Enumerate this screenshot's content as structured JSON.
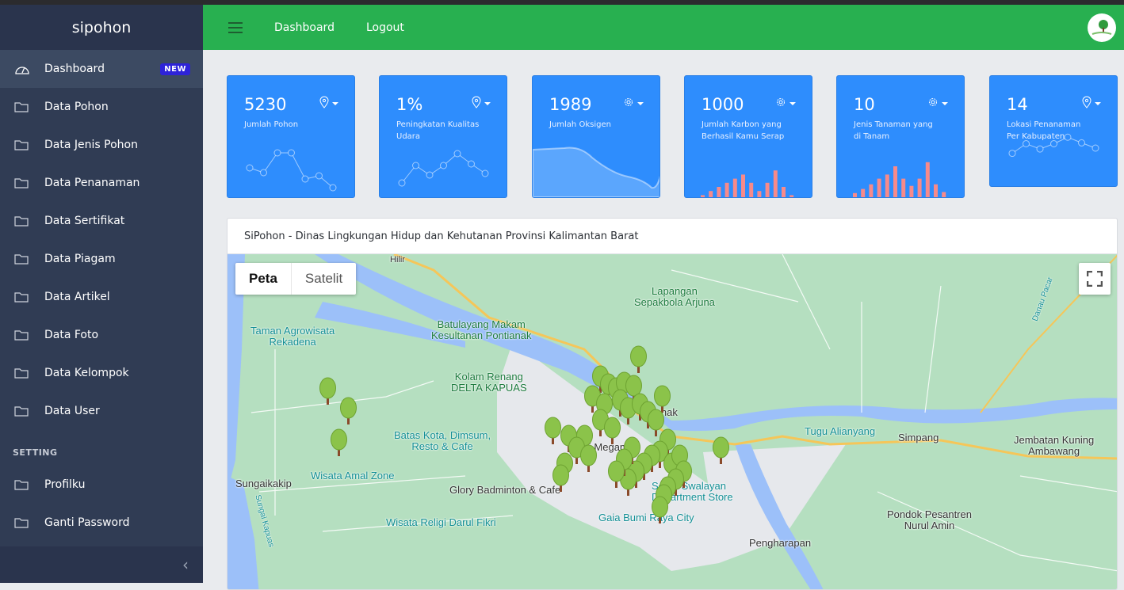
{
  "app": {
    "brand": "sipohon"
  },
  "header": {
    "links": [
      "Dashboard",
      "Logout"
    ]
  },
  "sidebar": {
    "items": [
      {
        "label": "Dashboard",
        "icon": "gauge-icon",
        "badge": "NEW",
        "active": true
      },
      {
        "label": "Data Pohon",
        "icon": "folder-icon"
      },
      {
        "label": "Data Jenis Pohon",
        "icon": "folder-icon"
      },
      {
        "label": "Data Penanaman",
        "icon": "folder-icon"
      },
      {
        "label": "Data Sertifikat",
        "icon": "folder-icon"
      },
      {
        "label": "Data Piagam",
        "icon": "folder-icon"
      },
      {
        "label": "Data Artikel",
        "icon": "folder-icon"
      },
      {
        "label": "Data Foto",
        "icon": "folder-icon"
      },
      {
        "label": "Data Kelompok",
        "icon": "folder-icon"
      },
      {
        "label": "Data User",
        "icon": "folder-icon"
      }
    ],
    "section": "SETTING",
    "settings": [
      {
        "label": "Profilku",
        "icon": "folder-icon"
      },
      {
        "label": "Ganti Password",
        "icon": "folder-icon"
      }
    ]
  },
  "cards": [
    {
      "value": "5230",
      "label": "Jumlah Pohon",
      "icon": "map-pin-icon",
      "chart": "line",
      "spark": [
        65,
        59,
        84,
        84,
        51,
        55,
        40
      ]
    },
    {
      "value": "1%",
      "label": "Peningkatan Kualitas Udara",
      "icon": "map-pin-icon",
      "chart": "line",
      "spark": [
        1,
        18,
        9,
        17,
        3,
        5,
        40
      ]
    },
    {
      "value": "1989",
      "label": "Jumlah Oksigen",
      "icon": "gear-icon",
      "chart": "area",
      "spark": [
        78,
        81,
        80,
        45,
        55,
        34,
        40
      ]
    },
    {
      "value": "1000",
      "label": "Jumlah Karbon yang Berhasil Kamu Serap",
      "icon": "gear-icon",
      "chart": "bar",
      "spark": [
        4,
        12,
        20,
        28,
        36,
        44,
        28,
        12,
        28,
        52,
        20,
        4
      ]
    },
    {
      "value": "10",
      "label": "Jenis Tanaman yang di Tanam",
      "icon": "gear-icon",
      "chart": "bar",
      "spark": [
        8,
        16,
        25,
        36,
        44,
        60,
        36,
        22,
        36,
        68,
        25,
        10
      ]
    },
    {
      "value": "14",
      "label": "Lokasi Penanaman Per Kabupaten",
      "icon": "map-pin-icon",
      "chart": "line",
      "spark": [
        1,
        18,
        9,
        17,
        3,
        5,
        40
      ]
    }
  ],
  "colors": {
    "header": "#28b050",
    "sidebar": "#303c54",
    "card": "#2e8dfd",
    "bar": "#f78a8a",
    "badge": "#2e23d8"
  },
  "map": {
    "title": "SiPohon - Dinas Lingkungan Hidup dan Kehutanan Provinsi Kalimantan Barat",
    "type_options": [
      "Peta",
      "Satelit"
    ],
    "selected_type": "Peta",
    "labels": {
      "lapangan": "Lapangan\nSepakbola Arjuna",
      "batulayang": "Batulayang Makam\nKesultanan Pontianak",
      "taman": "Taman Agrowisata\nRekadena",
      "kolam": "Kolam Renang\nDELTA KAPUAS",
      "batas": "Batas Kota, Dimsum,\nResto & Cafe",
      "wisata_amal": "Wisata Amal Zone",
      "sungaikakip": "Sungaikakip",
      "glory": "Glory Badminton & Cafe",
      "wisata_religi": "Wisata Religi Darul Fikri",
      "tugu": "Tugu Alianyang",
      "simpang": "Simpang",
      "jembatan": "Jembatan Kuning\nAmbawang",
      "pondok": "Pondok Pesantren\nNurul Amin",
      "pengharapan": "Pengharapan",
      "gaia": "Gaia Bumi Raya City",
      "swalayan": "Serek Swalayan\nDepartment Store",
      "megamall": "Ani Megamall",
      "pontianak": "Pontianak",
      "hilir": "Hilir",
      "sungai_kapuas": "Sungai Kapuas",
      "danau": "Danau Pacar"
    }
  }
}
